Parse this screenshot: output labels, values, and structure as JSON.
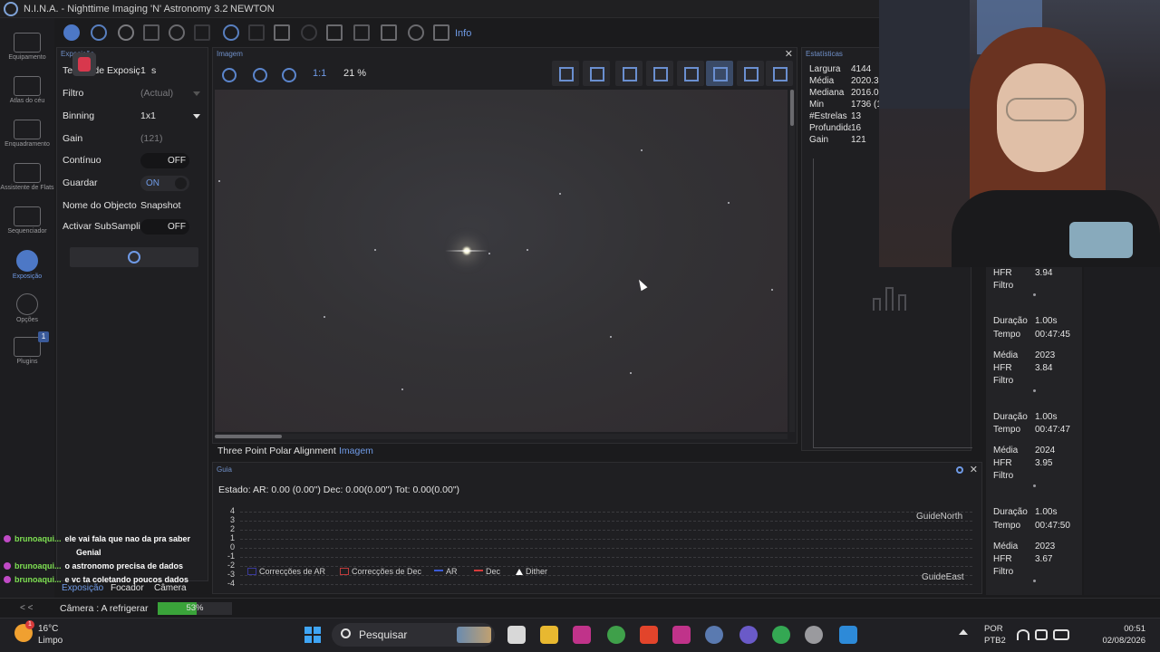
{
  "window": {
    "app_title": "N.I.N.A. - Nighttime Imaging 'N' Astronomy 3.2",
    "profile": "NEWTON"
  },
  "sidebar": {
    "items": [
      {
        "label": "Equipamento",
        "icon": "telescope-icon"
      },
      {
        "label": "Atlas do céu",
        "icon": "sky-atlas-icon"
      },
      {
        "label": "Enquadramento",
        "icon": "framing-icon"
      },
      {
        "label": "Assistente de Flats",
        "icon": "flat-wizard-icon"
      },
      {
        "label": "Sequenciador",
        "icon": "sequencer-icon"
      },
      {
        "label": "Exposição",
        "icon": "imaging-icon",
        "active": true
      },
      {
        "label": "Opções",
        "icon": "gear-icon"
      },
      {
        "label": "Plugins",
        "icon": "puzzle-icon",
        "badge": "1"
      }
    ]
  },
  "toolbar": {
    "info_label": "Info"
  },
  "exposure_panel": {
    "title": "Exposição",
    "rows": {
      "exposure_time_label": "Tempo de Exposiç",
      "exposure_time_value": "1",
      "exposure_time_unit": "s",
      "filter_label": "Filtro",
      "filter_value": "(Actual)",
      "binning_label": "Binning",
      "binning_value": "1x1",
      "gain_label": "Gain",
      "gain_value": "(121)",
      "continuous_label": "Contínuo",
      "continuous_value": "OFF",
      "save_label": "Guardar",
      "save_value": "ON",
      "target_name_label": "Nome do Objecto",
      "target_name_value": "Snapshot",
      "subsample_label": "Activar SubSampli",
      "subsample_value": "OFF"
    }
  },
  "image_panel": {
    "title": "Imagem",
    "zoom_one_to_one": "1:1",
    "zoom_percent": "21 %"
  },
  "image_tabs": {
    "tab1": "Three Point Polar Alignment",
    "tab2": "Imagem"
  },
  "stats_panel": {
    "title": "Estatísticas",
    "rows": [
      {
        "k": "Largura",
        "v": "4144"
      },
      {
        "k": "Média",
        "v": "2020.33"
      },
      {
        "k": "Mediana",
        "v": "2016.00"
      },
      {
        "k": "Min",
        "v": "1736 (1"
      },
      {
        "k": "#Estrelas",
        "v": "13"
      },
      {
        "k": "Profundidade",
        "v": "16"
      },
      {
        "k": "Gain",
        "v": "121"
      }
    ]
  },
  "frames": [
    {
      "k": "HFR",
      "v": "3.94"
    },
    {
      "k": "Filtro",
      "v": ""
    },
    {
      "k": "Duração",
      "v": "1.00s"
    },
    {
      "k": "Tempo",
      "v": "00:47:45"
    },
    {
      "k": "Média",
      "v": "2023"
    },
    {
      "k": "HFR",
      "v": "3.84"
    },
    {
      "k": "Filtro",
      "v": ""
    },
    {
      "k": "Duração",
      "v": "1.00s"
    },
    {
      "k": "Tempo",
      "v": "00:47:47"
    },
    {
      "k": "Média",
      "v": "2024"
    },
    {
      "k": "HFR",
      "v": "3.95"
    },
    {
      "k": "Filtro",
      "v": ""
    },
    {
      "k": "Duração",
      "v": "1.00s"
    },
    {
      "k": "Tempo",
      "v": "00:47:50"
    },
    {
      "k": "Média",
      "v": "2023"
    },
    {
      "k": "HFR",
      "v": "3.67"
    },
    {
      "k": "Filtro",
      "v": ""
    }
  ],
  "guide_panel": {
    "title": "Guia",
    "status": "Estado:  AR: 0.00 (0.00\")  Dec: 0.00(0.00\")  Tot: 0.00(0.00\")",
    "y_labels": [
      "4",
      "3",
      "2",
      "1",
      "0",
      "-1",
      "-2",
      "-3",
      "-4"
    ],
    "north_label": "GuideNorth",
    "east_label": "GuideEast",
    "legend": [
      {
        "label": "Correcções de AR",
        "color": "#2a2a8a"
      },
      {
        "label": "Correcções de Dec",
        "color": "#8a2a2a"
      },
      {
        "label": "AR",
        "color": "#3b5bd6"
      },
      {
        "label": "Dec",
        "color": "#d63b3b"
      },
      {
        "label": "Dither",
        "color": "#ffffff"
      }
    ]
  },
  "bottom_tabs": {
    "t1": "Exposição",
    "t2": "Focador",
    "t3": "Câmera"
  },
  "chat": [
    {
      "user": "brunoaqui...",
      "msg": "ele vai fala que nao da pra saber"
    },
    {
      "user": "",
      "msg": "Genial"
    },
    {
      "user": "brunoaqui...",
      "msg": "o astronomo precisa de dados"
    },
    {
      "user": "brunoaqui...",
      "msg": "e vc ta coletando poucos dados"
    }
  ],
  "status_bar": {
    "collapse": "< <",
    "camera_status": "Câmera :   A refrigerar",
    "progress_text": "53%",
    "progress_fraction": 0.53
  },
  "taskbar": {
    "weather_temp": "16°C",
    "weather_desc": "Limpo",
    "weather_badge": "1",
    "search_placeholder": "Pesquisar",
    "lang_line1": "POR",
    "lang_line2": "PTB2",
    "time": "00:51",
    "date": "02/08/2026"
  },
  "colors": {
    "accent": "#4d78c6",
    "progress": "#3aa33a",
    "chat_user": "#7ee052"
  }
}
